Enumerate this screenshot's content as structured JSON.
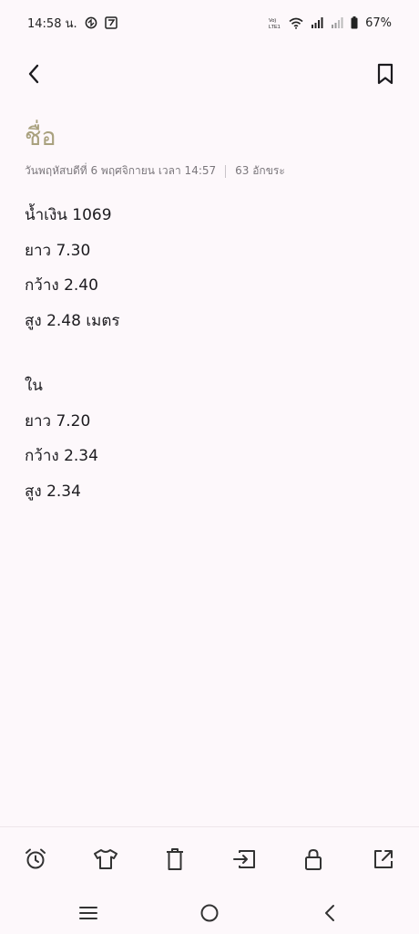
{
  "status_bar": {
    "time": "14:58 น.",
    "battery": "67%",
    "volte_label": "Vo) LTE1"
  },
  "note": {
    "title": "ชื่อ",
    "date": "วันพฤหัสบดีที่ 6 พฤศจิกายน เวลา 14:57",
    "char_count": "63 อักขระ",
    "lines": [
      "น้ำเงิน  1069",
      "ยาว 7.30",
      "กว้าง 2.40",
      "สูง 2.48 เมตร",
      "",
      "ใน",
      "ยาว 7.20",
      "กว้าง 2.34",
      "สูง 2.34"
    ]
  },
  "icons": {
    "back": "chevron-left-icon",
    "bookmark": "bookmark-icon",
    "toolbar": [
      "alarm-icon",
      "shirt-icon",
      "trash-icon",
      "move-icon",
      "lock-icon",
      "share-icon"
    ],
    "nav": [
      "menu-icon",
      "home-icon",
      "back-icon"
    ]
  },
  "colors": {
    "background": "#fdf8fb",
    "title": "#a9a17e",
    "meta": "#7b777c",
    "text": "#1c1b1f"
  }
}
